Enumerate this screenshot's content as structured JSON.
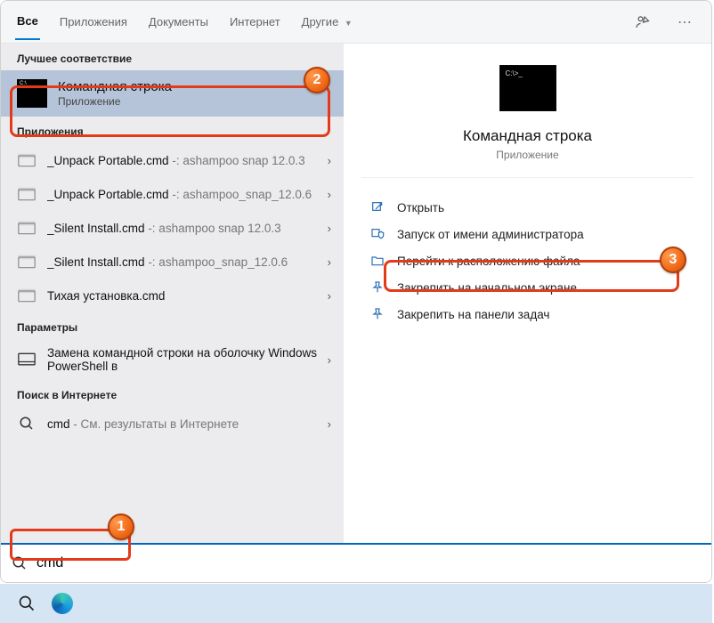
{
  "tabs": {
    "all": "Все",
    "apps": "Приложения",
    "docs": "Документы",
    "internet": "Интернет",
    "other": "Другие"
  },
  "sections": {
    "best": "Лучшее соответствие",
    "apps": "Приложения",
    "settings": "Параметры",
    "web": "Поиск в Интернете"
  },
  "bestMatch": {
    "title": "Командная строка",
    "sub": "Приложение"
  },
  "appResults": [
    {
      "name": "_Unpack Portable.cmd",
      "hint": " -: ashampoo snap 12.0.3"
    },
    {
      "name": "_Unpack Portable.cmd",
      "hint": " -: ashampoo_snap_12.0.6"
    },
    {
      "name": "_Silent Install.cmd",
      "hint": " -: ashampoo snap 12.0.3"
    },
    {
      "name": "_Silent Install.cmd",
      "hint": " -: ashampoo_snap_12.0.6"
    },
    {
      "name": "Тихая установка.cmd",
      "hint": ""
    }
  ],
  "settingsResult": {
    "title": "Замена командной строки на оболочку Windows PowerShell в"
  },
  "webResult": {
    "prefix": "cmd",
    "rest": " - См. результаты в Интернете"
  },
  "preview": {
    "title": "Командная строка",
    "sub": "Приложение"
  },
  "actions": {
    "open": "Открыть",
    "admin": "Запуск от имени администратора",
    "location": "Перейти к расположению файла",
    "pinStart": "Закрепить на начальном экране",
    "pinTaskbar": "Закрепить на панели задач"
  },
  "search": {
    "value": "cmd"
  },
  "badges": {
    "b1": "1",
    "b2": "2",
    "b3": "3"
  }
}
